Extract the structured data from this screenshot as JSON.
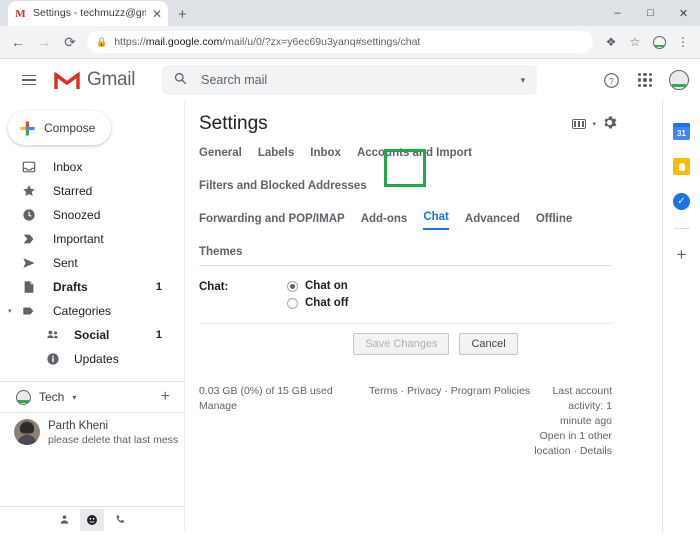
{
  "browser": {
    "tab_title": "Settings - techmuzz@gmail.com",
    "tab_favicon": "M",
    "tab_close": "✕",
    "new_tab": "+",
    "window": {
      "minimize": "–",
      "maximize": "□",
      "close": "✕"
    },
    "nav": {
      "back": "←",
      "forward": "→",
      "reload": "⟳"
    },
    "url": {
      "lock": "🔒",
      "scheme": "https://",
      "host": "mail.google.com",
      "path": "/mail/u/0/?zx=y6ec69u3yanq#settings/chat"
    },
    "toolbar_icons": {
      "extension": "❖",
      "bookmark": "☆",
      "profile": "●",
      "menu": "⋮"
    }
  },
  "header": {
    "menu_icon": "hamburger",
    "brand": "Gmail",
    "search": {
      "placeholder": "Search mail",
      "icon": "⌕",
      "caret": "▾"
    },
    "help_icon": "?",
    "apps_icon": "apps-grid",
    "avatar_icon": "avatar"
  },
  "sidebar": {
    "compose": "Compose",
    "items": [
      {
        "label": "Inbox",
        "icon": "☐",
        "count": "",
        "bold": false
      },
      {
        "label": "Starred",
        "icon": "★",
        "count": "",
        "bold": false
      },
      {
        "label": "Snoozed",
        "icon": "◔",
        "count": "",
        "bold": false
      },
      {
        "label": "Important",
        "icon": "❯",
        "count": "",
        "bold": false
      },
      {
        "label": "Sent",
        "icon": "➤",
        "count": "",
        "bold": false
      },
      {
        "label": "Drafts",
        "icon": "▧",
        "count": "1",
        "bold": true
      },
      {
        "label": "Categories",
        "icon": "⚑",
        "count": "",
        "bold": false,
        "caret": "▾"
      },
      {
        "label": "Social",
        "icon": "☻",
        "count": "1",
        "bold": true,
        "sub": true
      },
      {
        "label": "Updates",
        "icon": "ⓘ",
        "count": "",
        "bold": false,
        "sub": true
      }
    ],
    "chat": {
      "name": "Tech",
      "caret": "▾",
      "add": "+"
    },
    "contact": {
      "name": "Parth Kheni",
      "message": "please delete that last message, beca"
    },
    "bottom_bar": {
      "contacts": "♟",
      "chat": "☺",
      "phone": "☎"
    }
  },
  "settings": {
    "title": "Settings",
    "density_icon": "keyboard-icon",
    "density_caret": "▾",
    "gear_icon": "⚙",
    "tabs_row1": [
      {
        "label": "General",
        "active": false
      },
      {
        "label": "Labels",
        "active": false
      },
      {
        "label": "Inbox",
        "active": false
      },
      {
        "label": "Accounts and Import",
        "active": false
      },
      {
        "label": "Filters and Blocked Addresses",
        "active": false
      }
    ],
    "tabs_row2": [
      {
        "label": "Forwarding and POP/IMAP",
        "active": false
      },
      {
        "label": "Add-ons",
        "active": false
      },
      {
        "label": "Chat",
        "active": true
      },
      {
        "label": "Advanced",
        "active": false
      },
      {
        "label": "Offline",
        "active": false
      },
      {
        "label": "Themes",
        "active": false
      }
    ],
    "chat_section": {
      "label": "Chat:",
      "options": [
        {
          "label": "Chat on",
          "selected": true
        },
        {
          "label": "Chat off",
          "selected": false
        }
      ]
    },
    "buttons": {
      "save": "Save Changes",
      "cancel": "Cancel"
    },
    "highlight_color": "#1faa4b",
    "active_tab_color": "#1a73e8"
  },
  "footer": {
    "storage": "0.03 GB (0%) of 15 GB used",
    "manage": "Manage",
    "terms": "Terms",
    "privacy": "Privacy",
    "policies": "Program Policies",
    "separator": "·",
    "activity": "Last account activity: 1 minute ago",
    "location": "Open in 1 other location",
    "details": "Details"
  },
  "rail": {
    "calendar": "31",
    "keep": "keep-icon",
    "tasks": "✓",
    "add": "+"
  }
}
